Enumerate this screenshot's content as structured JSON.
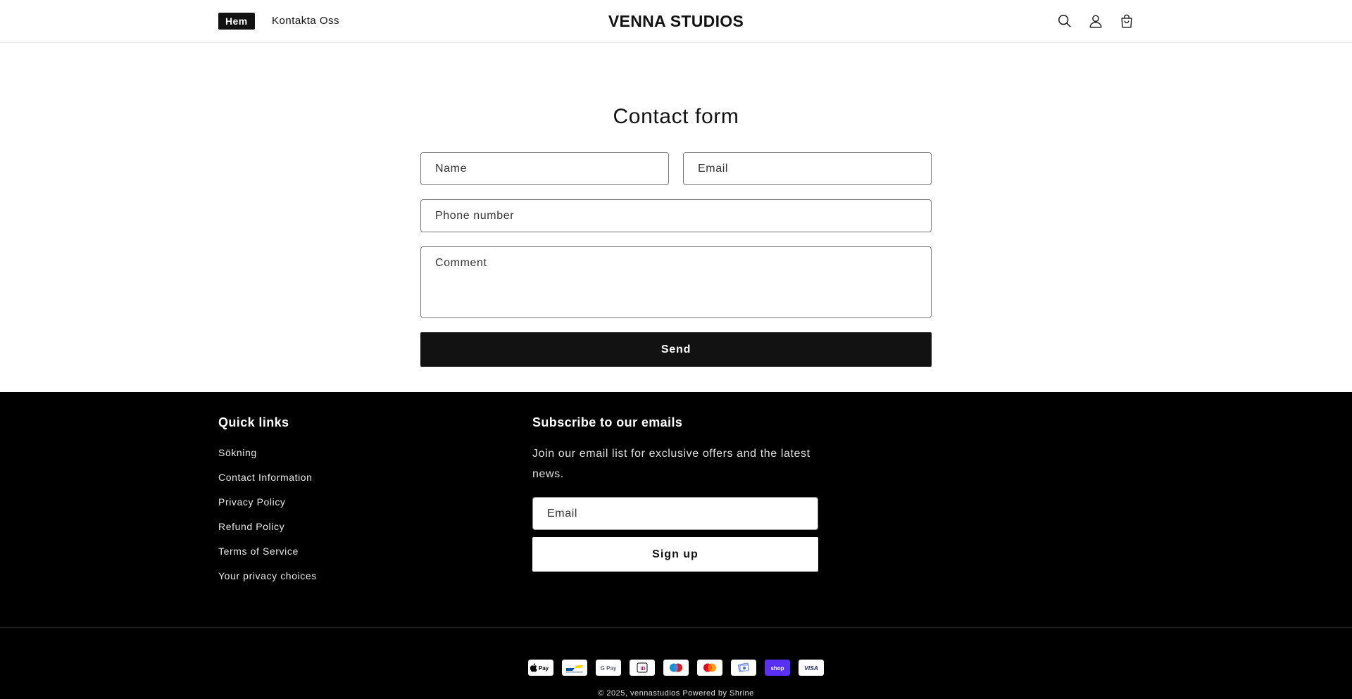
{
  "header": {
    "nav": [
      {
        "label": "Hem"
      },
      {
        "label": "Kontakta Oss"
      }
    ],
    "logo": "VENNA STUDIOS",
    "icons": [
      "search-icon",
      "account-icon",
      "cart-icon"
    ]
  },
  "contact_form": {
    "title": "Contact form",
    "name_placeholder": "Name",
    "email_placeholder": "Email",
    "phone_placeholder": "Phone number",
    "comment_placeholder": "Comment",
    "submit_label": "Send"
  },
  "footer": {
    "quick_links_heading": "Quick links",
    "quick_links": [
      "Sökning",
      "Contact Information",
      "Privacy Policy",
      "Refund Policy",
      "Terms of Service",
      "Your privacy choices"
    ],
    "subscribe_heading": "Subscribe to our emails",
    "subscribe_text": "Join our email list for exclusive offers and the latest news.",
    "subscribe_placeholder": "Email",
    "signup_label": "Sign up",
    "payment_methods": [
      {
        "name": "apple-pay",
        "label": "Pay",
        "bg": "#ffffff",
        "fg": "#000000"
      },
      {
        "name": "bancontact",
        "label": "",
        "bg": "#ffffff",
        "fg": "#1e3764"
      },
      {
        "name": "google-pay",
        "label": "G Pay",
        "bg": "#ffffff",
        "fg": "#5f6368"
      },
      {
        "name": "ideal",
        "label": "iD",
        "bg": "#ffffff",
        "fg": "#cc0066"
      },
      {
        "name": "maestro",
        "label": "",
        "bg": "#ffffff",
        "fg": "#000000"
      },
      {
        "name": "mastercard",
        "label": "",
        "bg": "#ffffff",
        "fg": "#000000"
      },
      {
        "name": "generic-card",
        "label": "",
        "bg": "#ffffff",
        "fg": "#4a6fd8"
      },
      {
        "name": "shop-pay",
        "label": "shop",
        "bg": "#5a31f4",
        "fg": "#ffffff"
      },
      {
        "name": "visa",
        "label": "VISA",
        "bg": "#ffffff",
        "fg": "#1a1f71"
      }
    ],
    "copyright_year": "© 2025,",
    "copyright_store": "vennastudios",
    "powered_by": "Powered by Shrine"
  }
}
